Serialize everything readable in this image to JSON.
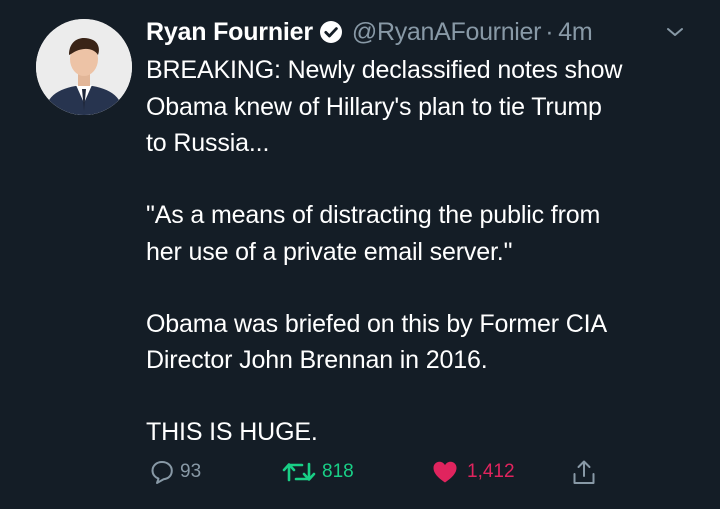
{
  "tweet": {
    "display_name": "Ryan Fournier",
    "handle": "@RyanAFournier",
    "separator": "·",
    "time": "4m",
    "paragraphs": [
      "BREAKING: Newly declassified notes show\nObama knew of Hillary's plan to tie Trump\nto Russia...",
      "\"As a means of distracting the public from\nher use of a private email server.\"",
      "Obama was briefed on this by Former CIA\nDirector John Brennan in 2016.",
      "THIS IS HUGE."
    ]
  },
  "actions": {
    "reply_count": "93",
    "retweet_count": "818",
    "like_count": "1,412"
  },
  "icons": {
    "verified": "verified-badge-icon",
    "menu": "chevron-down-icon",
    "reply": "reply-icon",
    "retweet": "retweet-icon",
    "like": "heart-icon",
    "share": "share-icon"
  },
  "colors": {
    "background": "#141d26",
    "text": "#ffffff",
    "muted": "#8899a6",
    "retweet": "#19cf86",
    "like": "#e0245e"
  }
}
